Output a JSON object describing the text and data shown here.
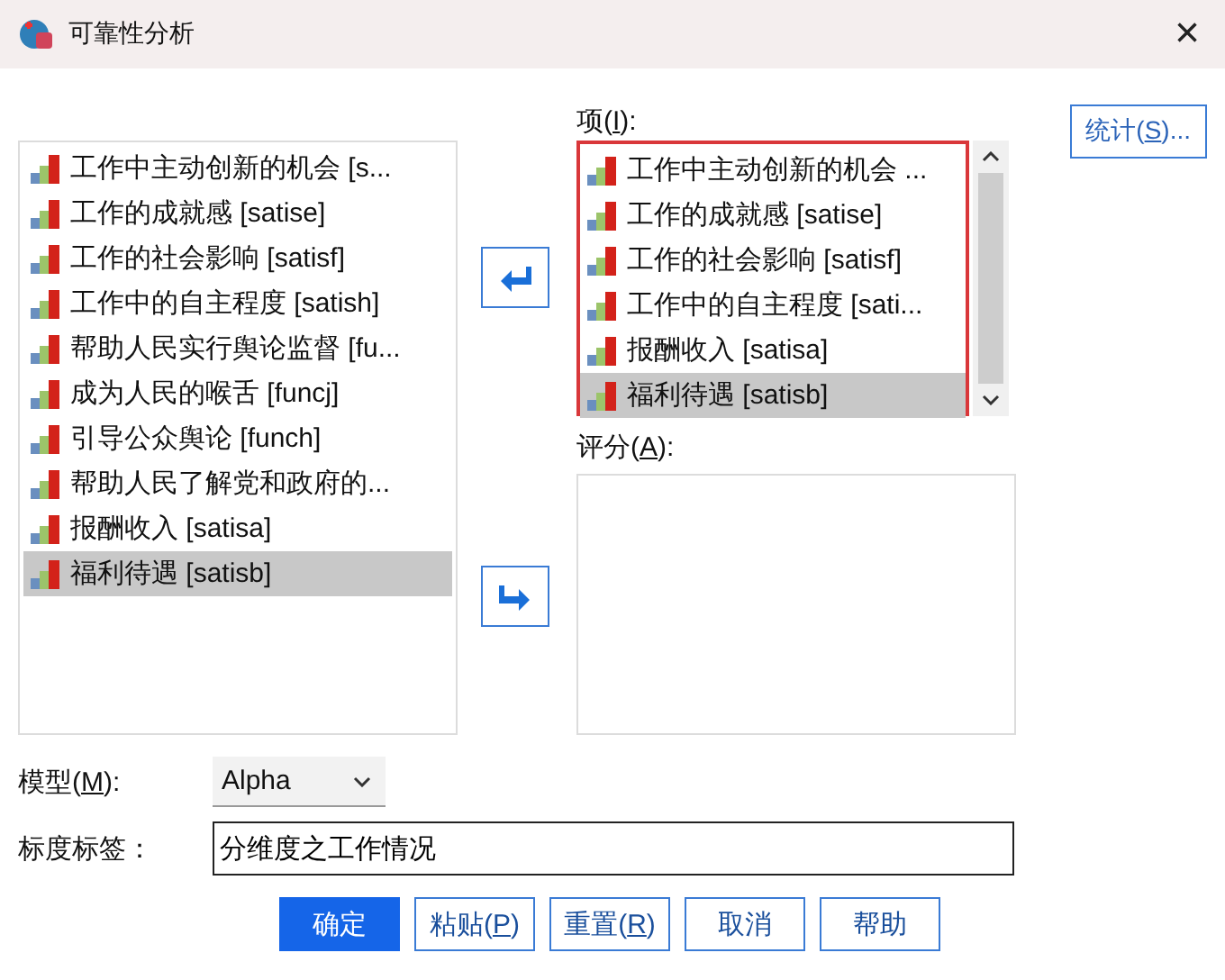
{
  "window": {
    "title": "可靠性分析",
    "close": "×"
  },
  "source_list": {
    "items": [
      {
        "label": "工作中主动创新的机会 [s...",
        "selected": false
      },
      {
        "label": "工作的成就感 [satise]",
        "selected": false
      },
      {
        "label": "工作的社会影响 [satisf]",
        "selected": false
      },
      {
        "label": "工作中的自主程度 [satish]",
        "selected": false
      },
      {
        "label": "帮助人民实行舆论监督 [fu...",
        "selected": false
      },
      {
        "label": "成为人民的喉舌 [funcj]",
        "selected": false
      },
      {
        "label": "引导公众舆论 [funch]",
        "selected": false
      },
      {
        "label": "帮助人民了解党和政府的...",
        "selected": false
      },
      {
        "label": "报酬收入 [satisa]",
        "selected": false
      },
      {
        "label": "福利待遇 [satisb]",
        "selected": true
      }
    ]
  },
  "items_label": {
    "pre": "项(",
    "key": "I",
    "post": "):"
  },
  "items_list": {
    "highlighted": true,
    "items": [
      {
        "label": "工作中主动创新的机会 ...",
        "selected": false
      },
      {
        "label": "工作的成就感 [satise]",
        "selected": false
      },
      {
        "label": "工作的社会影响 [satisf]",
        "selected": false
      },
      {
        "label": "工作中的自主程度 [sati...",
        "selected": false
      },
      {
        "label": "报酬收入 [satisa]",
        "selected": false
      },
      {
        "label": "福利待遇 [satisb]",
        "selected": true
      }
    ]
  },
  "rating_label": {
    "pre": "评分(",
    "key": "A",
    "post": "):"
  },
  "statistics_button": {
    "pre": "统计(",
    "key": "S",
    "post": ")..."
  },
  "model": {
    "label": {
      "pre": "模型(",
      "key": "M",
      "post": "):"
    },
    "value": "Alpha"
  },
  "scale_label": {
    "label": "标度标签：",
    "value": "分维度之工作情况"
  },
  "buttons": [
    {
      "pre": "确定",
      "primary": true
    },
    {
      "pre": "粘贴(",
      "key": "P",
      "post": ")",
      "primary": false
    },
    {
      "pre": "重置(",
      "key": "R",
      "post": ")",
      "primary": false
    },
    {
      "pre": "取消",
      "primary": false
    },
    {
      "pre": "帮助",
      "primary": false
    }
  ]
}
